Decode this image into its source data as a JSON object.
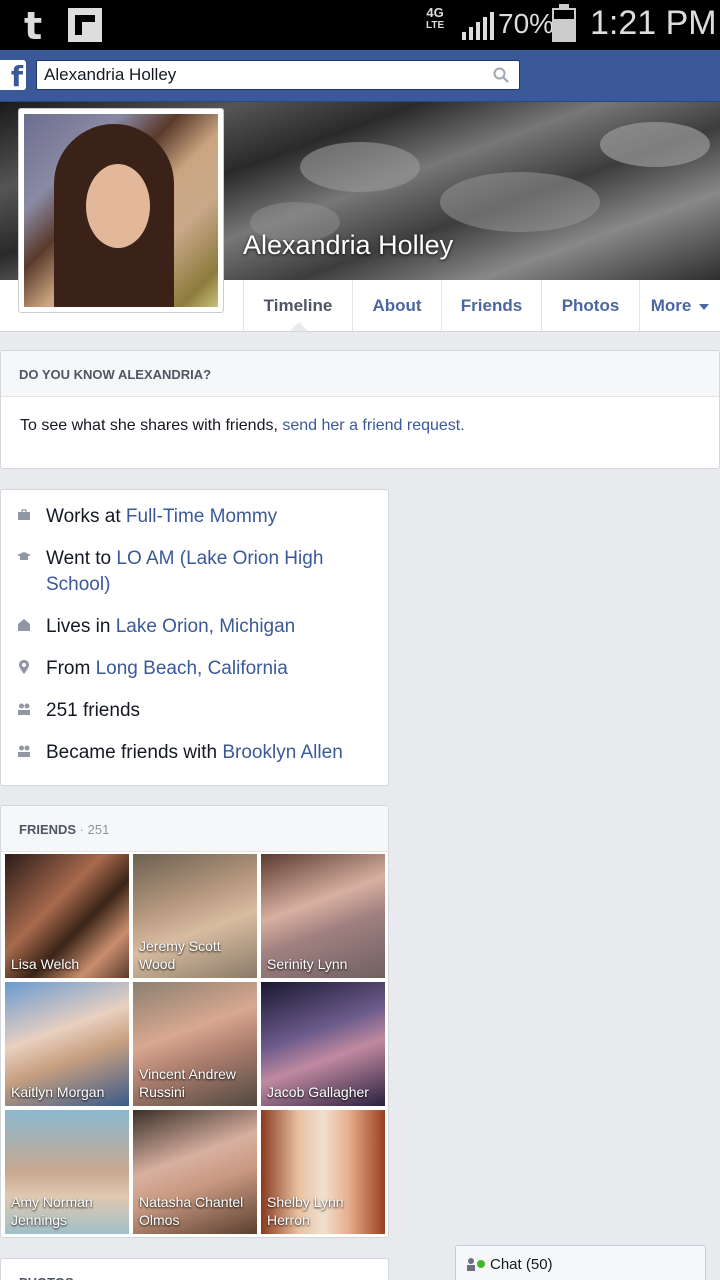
{
  "status_bar": {
    "network": "4G",
    "network_sub": "LTE",
    "battery": "70%",
    "battery_level": 0.7,
    "time": "1:21 PM"
  },
  "header": {
    "search_value": "Alexandria Holley"
  },
  "profile": {
    "name": "Alexandria Holley"
  },
  "tabs": [
    {
      "label": "Timeline"
    },
    {
      "label": "About"
    },
    {
      "label": "Friends"
    },
    {
      "label": "Photos"
    },
    {
      "label": "More"
    }
  ],
  "know_card": {
    "title": "DO YOU KNOW ALEXANDRIA?",
    "text": "To see what she shares with friends, ",
    "link": "send her a friend request."
  },
  "info": {
    "work_prefix": "Works at ",
    "work_link": "Full-Time Mommy",
    "school_prefix": "Went to ",
    "school_link": "LO AM (Lake Orion High School)",
    "lives_prefix": "Lives in ",
    "lives_link": "Lake Orion, Michigan",
    "from_prefix": "From ",
    "from_link": "Long Beach, California",
    "friends_count": "251 friends",
    "became_prefix": "Became friends with ",
    "became_link": "Brooklyn Allen"
  },
  "friends_card": {
    "title": "FRIENDS",
    "count": " · 251",
    "items": [
      {
        "name": "Lisa Welch"
      },
      {
        "name": "Jeremy Scott Wood"
      },
      {
        "name": "Serinity Lynn"
      },
      {
        "name": "Kaitlyn Morgan"
      },
      {
        "name": "Vincent Andrew Russini"
      },
      {
        "name": "Jacob Gallagher"
      },
      {
        "name": "Amy Norman Jennings"
      },
      {
        "name": "Natasha Chantel Olmos"
      },
      {
        "name": "Shelby Lynn Herron"
      }
    ]
  },
  "photos_card": {
    "title": "PHOTOS"
  },
  "chat": {
    "label": "Chat (50)"
  }
}
